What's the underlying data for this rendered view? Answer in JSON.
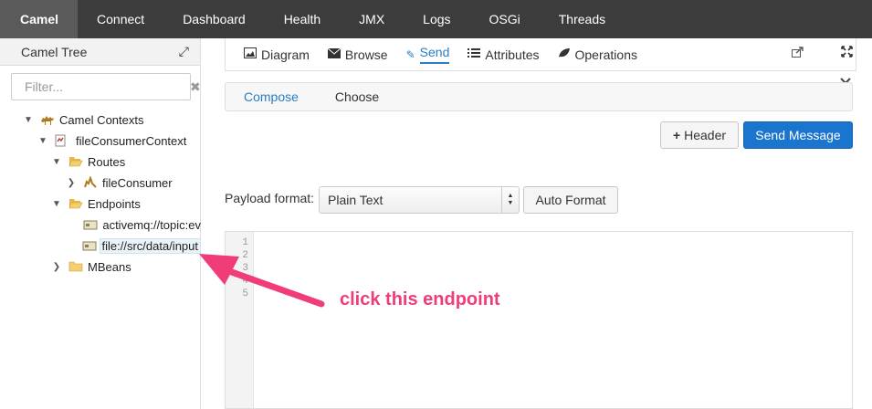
{
  "topnav": {
    "items": [
      {
        "label": "Camel"
      },
      {
        "label": "Connect"
      },
      {
        "label": "Dashboard"
      },
      {
        "label": "Health"
      },
      {
        "label": "JMX"
      },
      {
        "label": "Logs"
      },
      {
        "label": "OSGi"
      },
      {
        "label": "Threads"
      }
    ],
    "active": "Camel"
  },
  "tree": {
    "title": "Camel Tree",
    "filter_placeholder": "Filter...",
    "nodes": [
      {
        "label": "Camel Contexts",
        "icon": "camel-icon"
      },
      {
        "label": "fileConsumerContext",
        "icon": "context-icon"
      },
      {
        "label": "Routes",
        "icon": "folder-open-icon"
      },
      {
        "label": "fileConsumer",
        "icon": "route-icon"
      },
      {
        "label": "Endpoints",
        "icon": "folder-open-icon"
      },
      {
        "label": "activemq://topic:ev",
        "icon": "endpoint-icon"
      },
      {
        "label": "file://src/data/input",
        "icon": "endpoint-icon"
      },
      {
        "label": "MBeans",
        "icon": "folder-icon"
      }
    ],
    "selected": "file://src/data/input"
  },
  "tabs": {
    "items": [
      {
        "label": "Diagram",
        "icon": "image-icon"
      },
      {
        "label": "Browse",
        "icon": "envelope-icon"
      },
      {
        "label": "Send",
        "icon": "pencil-icon"
      },
      {
        "label": "Attributes",
        "icon": "list-icon"
      },
      {
        "label": "Operations",
        "icon": "leaf-icon"
      }
    ],
    "active": "Send"
  },
  "subtabs": {
    "items": [
      {
        "label": "Compose"
      },
      {
        "label": "Choose"
      }
    ],
    "active": "Compose"
  },
  "actions": {
    "header_label": "Header",
    "send_label": "Send Message"
  },
  "payload": {
    "label": "Payload format:",
    "selected": "Plain Text",
    "autoformat_label": "Auto Format"
  },
  "editor": {
    "line_numbers": [
      "1",
      "2",
      "3",
      "4",
      "5"
    ]
  },
  "annotation": {
    "text": "click this endpoint",
    "color": "#f03c77"
  }
}
